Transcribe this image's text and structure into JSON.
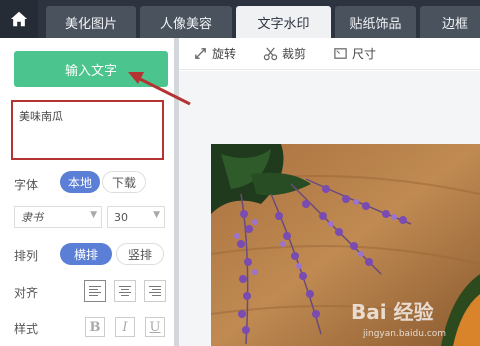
{
  "tabs": [
    {
      "label": "美化图片",
      "active": false
    },
    {
      "label": "人像美容",
      "active": false
    },
    {
      "label": "文字水印",
      "active": true
    },
    {
      "label": "贴纸饰品",
      "active": false
    },
    {
      "label": "边框",
      "active": false
    }
  ],
  "left_panel": {
    "input_button": "输入文字",
    "text_value": "美味南瓜",
    "font": {
      "label": "字体",
      "options": [
        "本地",
        "下载"
      ],
      "selected": "本地",
      "font_name": "隶书",
      "size": "30"
    },
    "arrange": {
      "label": "排列",
      "options": [
        "横排",
        "竖排"
      ],
      "selected": "横排"
    },
    "align": {
      "label": "对齐",
      "selected": "left"
    },
    "style": {
      "label": "样式",
      "buttons": [
        "B",
        "I",
        "U"
      ]
    }
  },
  "toolbar": {
    "rotate": "旋转",
    "crop": "裁剪",
    "size": "尺寸"
  },
  "colors": {
    "topbar": "#2d3440",
    "accent_green": "#4cc48d",
    "accent_blue": "#5b7fd6",
    "annotation_red": "#b43434"
  },
  "watermark": {
    "text": "Bai 经验",
    "subtext": "jingyan.baidu.com"
  }
}
